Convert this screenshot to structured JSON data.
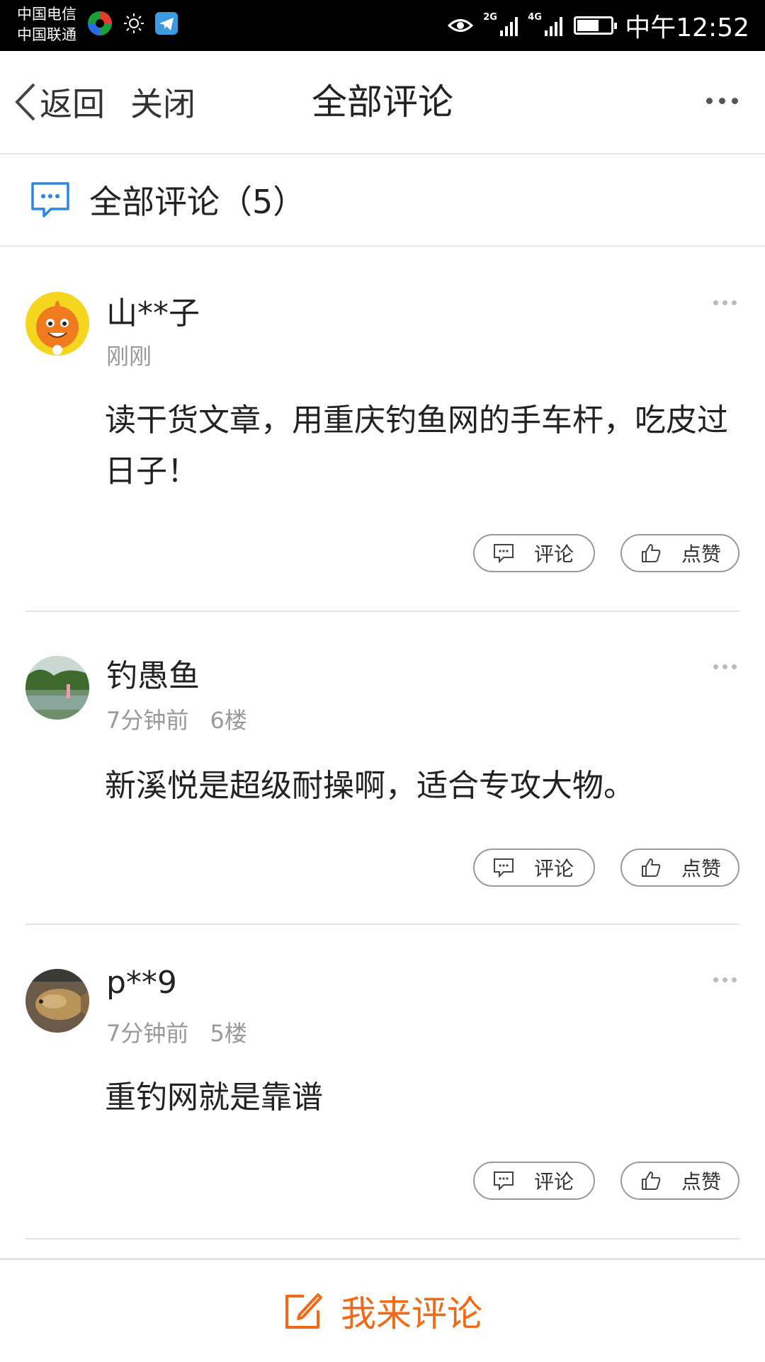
{
  "status_bar": {
    "carrier1": "中国电信",
    "carrier2": "中国联通",
    "network1": "2G",
    "network2": "4G",
    "time": "中午12:52",
    "battery_level": 0.65
  },
  "header": {
    "back_label": "返回",
    "close_label": "关闭",
    "title": "全部评论"
  },
  "comments_section": {
    "title": "全部评论（5）"
  },
  "comments": [
    {
      "author": "山**子",
      "time": "刚刚",
      "floor": "",
      "content": "读干货文章，用重庆钓鱼网的手车杆，吃皮过日子！",
      "reply_label": "评论",
      "like_label": "点赞"
    },
    {
      "author": "钓愚鱼",
      "time": "7分钟前",
      "floor": "6楼",
      "content": "新溪悦是超级耐操啊，适合专攻大物。",
      "reply_label": "评论",
      "like_label": "点赞"
    },
    {
      "author": "p**9",
      "time": "7分钟前",
      "floor": "5楼",
      "content": "重钓网就是靠谱",
      "reply_label": "评论",
      "like_label": "点赞"
    }
  ],
  "footer": {
    "write_comment_label": "我来评论"
  },
  "colors": {
    "accent": "#f06a18",
    "comment_icon": "#2b86e6"
  }
}
